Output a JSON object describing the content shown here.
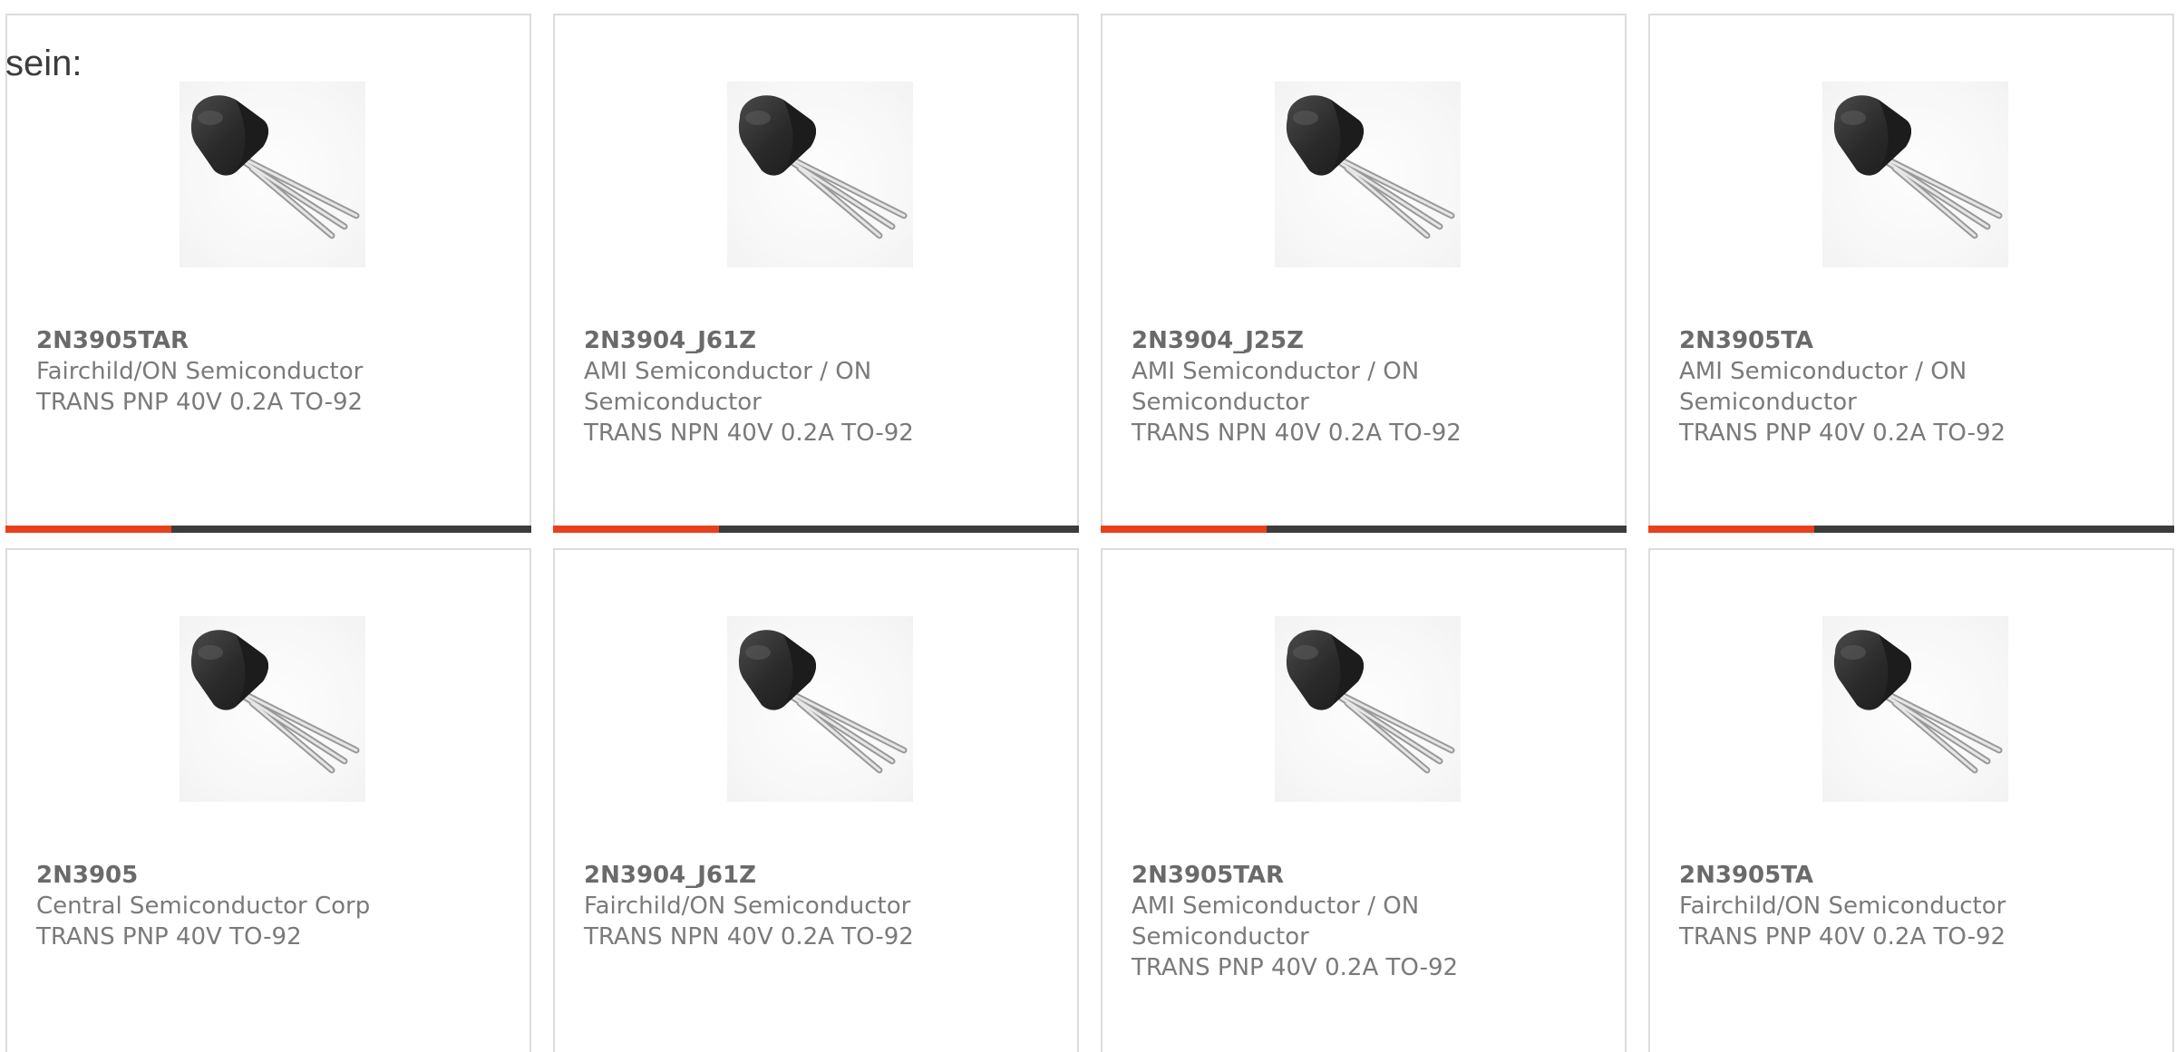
{
  "intro_text": "sein:",
  "colors": {
    "accent": "#e8401c",
    "bar": "#3c3c3c",
    "border": "#dcdcdc"
  },
  "products": [
    {
      "part": "2N3905TAR",
      "maker": "Fairchild/ON Semiconductor",
      "description": "TRANS PNP 40V 0.2A TO-92",
      "image_icon": "to92-transistor-icon"
    },
    {
      "part": "2N3904_J61Z",
      "maker": "AMI Semiconductor / ON Semiconductor",
      "description": "TRANS NPN 40V 0.2A TO-92",
      "image_icon": "to92-transistor-icon"
    },
    {
      "part": "2N3904_J25Z",
      "maker": "AMI Semiconductor / ON Semiconductor",
      "description": "TRANS NPN 40V 0.2A TO-92",
      "image_icon": "to92-transistor-icon"
    },
    {
      "part": "2N3905TA",
      "maker": "AMI Semiconductor / ON Semiconductor",
      "description": "TRANS PNP 40V 0.2A TO-92",
      "image_icon": "to92-transistor-icon"
    },
    {
      "part": "2N3905",
      "maker": "Central Semiconductor Corp",
      "description": "TRANS PNP 40V TO-92",
      "image_icon": "to92-transistor-icon"
    },
    {
      "part": "2N3904_J61Z",
      "maker": "Fairchild/ON Semiconductor",
      "description": "TRANS NPN 40V 0.2A TO-92",
      "image_icon": "to92-transistor-icon"
    },
    {
      "part": "2N3905TAR",
      "maker": "AMI Semiconductor / ON Semiconductor",
      "description": "TRANS PNP 40V 0.2A TO-92",
      "image_icon": "to92-transistor-icon"
    },
    {
      "part": "2N3905TA",
      "maker": "Fairchild/ON Semiconductor",
      "description": "TRANS PNP 40V 0.2A TO-92",
      "image_icon": "to92-transistor-icon"
    }
  ]
}
